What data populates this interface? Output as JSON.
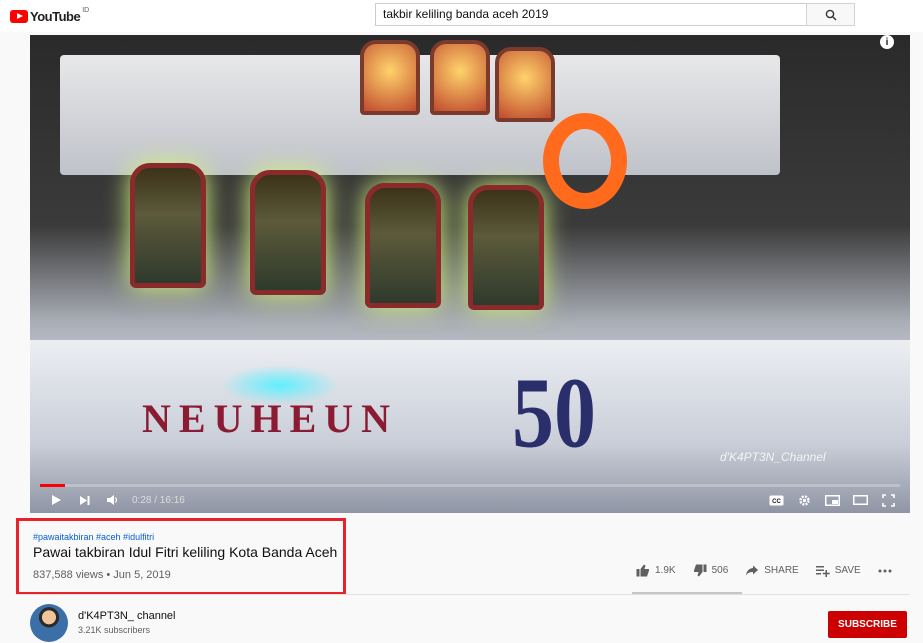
{
  "header": {
    "logo_text": "YouTube",
    "region": "ID",
    "search_value": "takbir keliling banda aceh 2019"
  },
  "player": {
    "hull_name": "NEUHEUN",
    "hull_number": "50",
    "watermark": "d'K4PT3N_Channel",
    "info_label": "i",
    "current_time": "0:28",
    "duration": "16:16",
    "time_display": "0:28 / 16:16",
    "progress_fraction": 0.029,
    "cc_label": "CC"
  },
  "video": {
    "tags": "#pawaitakbiran #aceh #idulfitri",
    "title": "Pawai takbiran Idul Fitri keliling Kota Banda Aceh",
    "views_date": "837,588 views • Jun 5, 2019"
  },
  "actions": {
    "likes": "1.9K",
    "dislikes": "506",
    "share": "SHARE",
    "save": "SAVE"
  },
  "channel": {
    "name": "d'K4PT3N_ channel",
    "subscribers": "3.21K subscribers",
    "subscribe_label": "SUBSCRIBE"
  },
  "colors": {
    "accent": "#ff0000",
    "highlight_box": "#e8212a",
    "subscribe": "#cc0000",
    "tags": "#065fd4"
  }
}
